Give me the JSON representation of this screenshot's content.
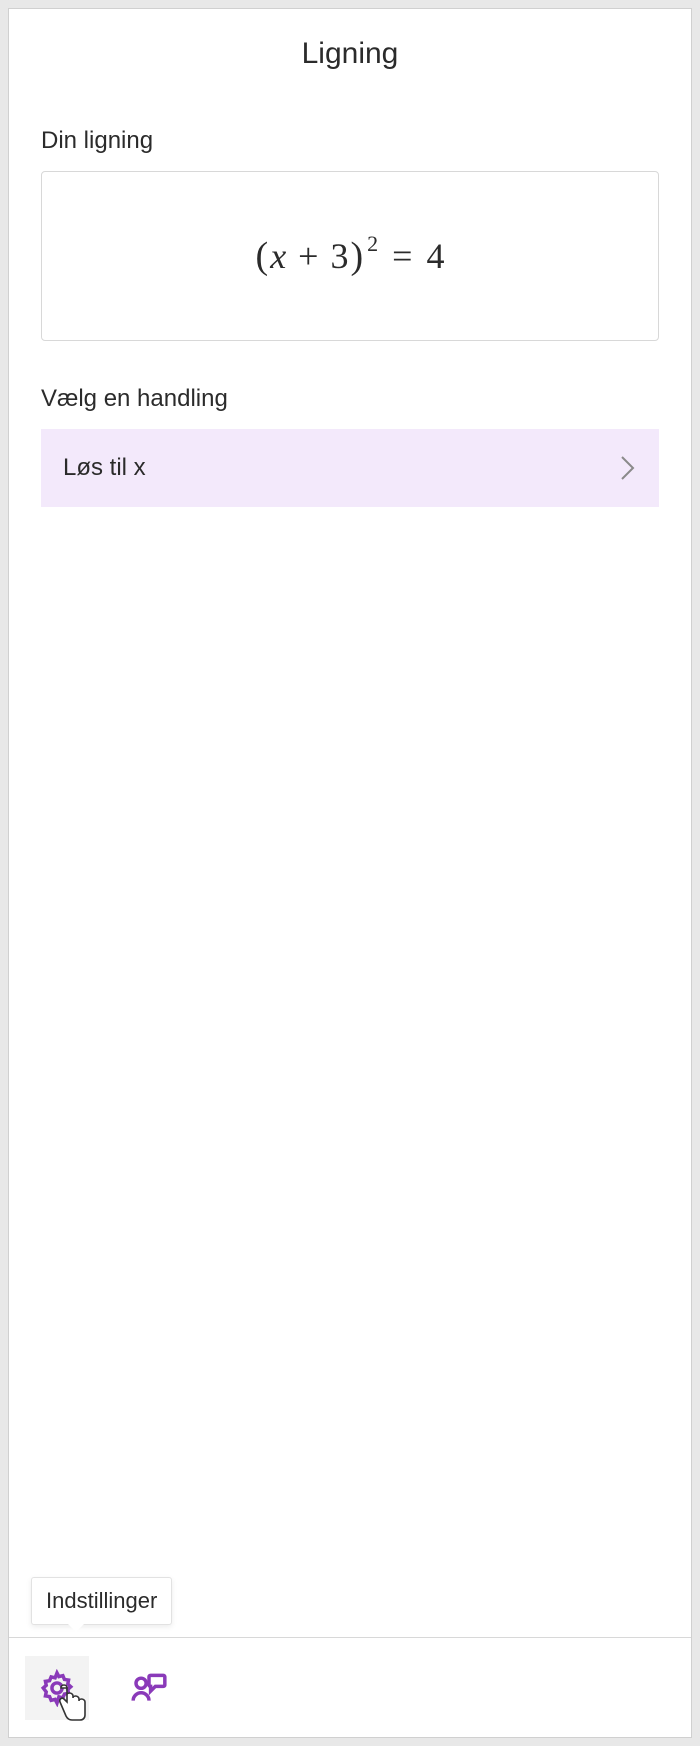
{
  "header": {
    "title": "Ligning"
  },
  "equation_section": {
    "label": "Din ligning",
    "equation_display": "(x + 3)² = 4",
    "equation_parts": {
      "lparen": "(",
      "var": "x",
      "op": "+",
      "const": "3",
      "rparen": ")",
      "exp": "2",
      "eq": "=",
      "rhs": "4"
    }
  },
  "action_section": {
    "label": "Vælg en handling",
    "items": [
      {
        "label": "Løs til x"
      }
    ]
  },
  "tooltip": {
    "text": "Indstillinger"
  },
  "bottom_bar": {
    "settings_icon": "gear-icon",
    "feedback_icon": "feedback-icon"
  },
  "colors": {
    "accent": "#8a3ab9",
    "action_bg": "#f3e9fb"
  }
}
